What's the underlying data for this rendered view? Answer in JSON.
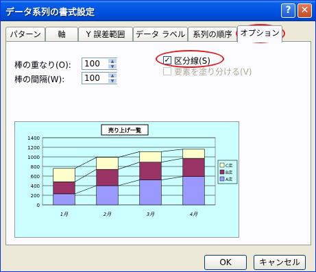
{
  "window": {
    "title": "データ系列の書式設定",
    "help_glyph": "?",
    "close_glyph": "✕"
  },
  "tabs": [
    "パターン",
    "軸",
    "Y 誤差範囲",
    "データ ラベル",
    "系列の順序",
    "オプション"
  ],
  "options": {
    "overlap_label": "棒の重なり(O):",
    "overlap_value": "100",
    "gap_label": "棒の間隔(W):",
    "gap_value": "100",
    "series_lines_label": "区分線(S)",
    "series_lines_checked": true,
    "vary_colors_label": "要素を塗り分ける(V)",
    "vary_colors_checked": false,
    "vary_colors_enabled": false
  },
  "chart_data": {
    "type": "bar",
    "title": "売り上げ一覧",
    "categories": [
      "1月",
      "2月",
      "3月",
      "4月"
    ],
    "series": [
      {
        "name": "A店",
        "color": "#9999ff",
        "values": [
          230,
          400,
          520,
          590
        ]
      },
      {
        "name": "B店",
        "color": "#993366",
        "values": [
          250,
          340,
          370,
          380
        ]
      },
      {
        "name": "C店",
        "color": "#ffffcc",
        "values": [
          280,
          250,
          220,
          190
        ]
      }
    ],
    "stacked": true,
    "series_lines": true,
    "ylim": [
      0,
      1400
    ],
    "yticks": [
      "0",
      "200",
      "400",
      "600",
      "800",
      "1000",
      "1200",
      "1400"
    ],
    "legend_position": "right",
    "grid": true
  },
  "buttons": {
    "ok": "OK",
    "cancel": "キャンセル"
  },
  "colors": {
    "titlebar": "#0054e3",
    "highlight": "#e31b23",
    "chart_bg": "#ccffff"
  }
}
